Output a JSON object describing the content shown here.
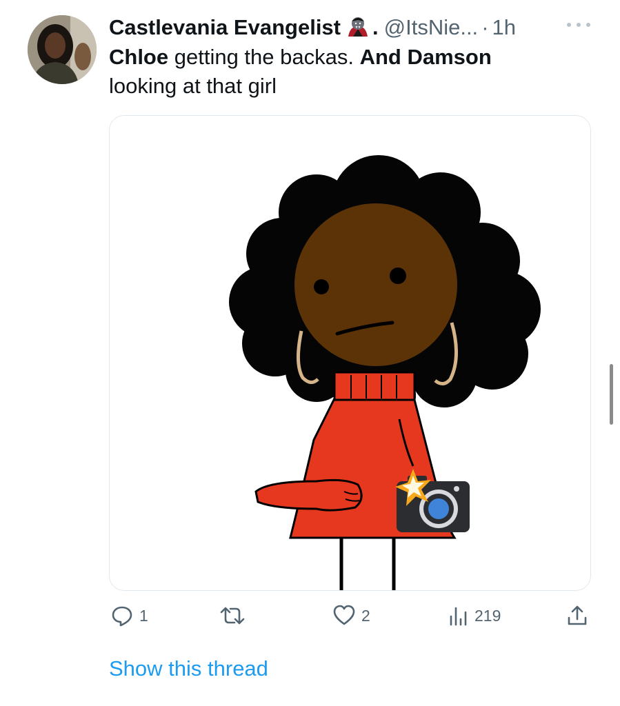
{
  "tweet": {
    "author_name": "Castlevania Evangelist",
    "author_dot": ".",
    "handle": "@ItsNie...",
    "separator": "·",
    "timestamp": "1h",
    "text_bold_1": "Chloe",
    "text_plain_1": " getting the backas. ",
    "text_bold_2": "And Damson",
    "text_plain_2": " looking at that girl",
    "badge_icon": "vampire-emoji-icon",
    "more_icon": "more-options-icon",
    "media_description_icon": "camera-flash-emoji-icon"
  },
  "actions": {
    "reply_count": "1",
    "retweet_count": "",
    "like_count": "2",
    "views_count": "219"
  },
  "footer": {
    "show_thread_label": "Show this thread"
  },
  "colors": {
    "link": "#1d9bf0",
    "secondary_text": "#536471",
    "primary_text": "#0f1419"
  }
}
